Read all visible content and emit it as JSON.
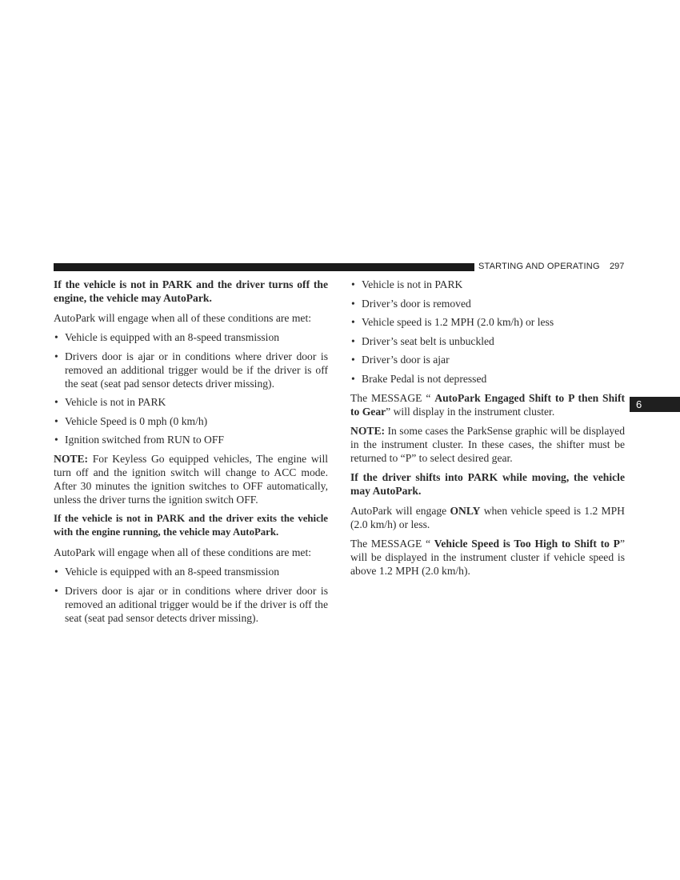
{
  "header": {
    "section": "STARTING AND OPERATING",
    "page_number": "297"
  },
  "chapter_tab": "6",
  "left_column": {
    "heading1": "If the vehicle is not in PARK and the driver turns off the engine, the vehicle may AutoPark.",
    "intro1": "AutoPark will engage when all of these conditions are met:",
    "bullets1": [
      "Vehicle is equipped with an 8-speed transmission",
      "Drivers door is ajar or in conditions where driver door is removed an additional trigger would be if the driver is off the seat (seat pad sensor detects driver missing).",
      "Vehicle is not in PARK",
      "Vehicle Speed is 0 mph (0 km/h)",
      "Ignition switched from RUN to OFF"
    ],
    "note_label": "NOTE:",
    "note_text": " For Keyless Go equipped vehicles, The engine will turn off and the ignition switch will change to ACC mode. After 30 minutes the ignition switches to OFF automatically, unless the driver turns the ignition switch OFF.",
    "heading2": "If the vehicle is not in PARK and the driver exits the vehicle with the engine running, the vehicle may AutoPark.",
    "intro2": "AutoPark will engage when all of these conditions are met:",
    "bullets2": [
      "Vehicle is equipped with an 8-speed transmission",
      "Drivers door is ajar or in conditions where driver door is removed an aditional trigger would be if the driver is off the seat (seat pad sensor detects driver missing)."
    ]
  },
  "right_column": {
    "bullets": [
      "Vehicle is not in PARK",
      "Driver’s door is removed",
      "Vehicle speed is 1.2 MPH (2.0 km/h) or less",
      "Driver’s seat belt is unbuckled",
      "Driver’s door is ajar",
      "Brake Pedal is not depressed"
    ],
    "msg1_pre": "The MESSAGE “ ",
    "msg1_bold": "AutoPark Engaged Shift to P then Shift to Gear",
    "msg1_post": "” will display in the instrument cluster.",
    "note_label": "NOTE:",
    "note_text": " In some cases the ParkSense graphic will be displayed in the instrument cluster. In these cases, the shifter must be returned to “P” to select desired gear.",
    "heading": "If the driver shifts into PARK while moving, the vehicle may AutoPark.",
    "engage_pre": "AutoPark will engage ",
    "engage_bold": "ONLY",
    "engage_post": " when vehicle speed is 1.2 MPH (2.0 km/h) or less.",
    "msg2_pre": "The MESSAGE “ ",
    "msg2_bold": "Vehicle Speed is Too High to Shift to P",
    "msg2_post": "” will be displayed in the instrument cluster if vehicle speed is above 1.2 MPH (2.0 km/h)."
  }
}
